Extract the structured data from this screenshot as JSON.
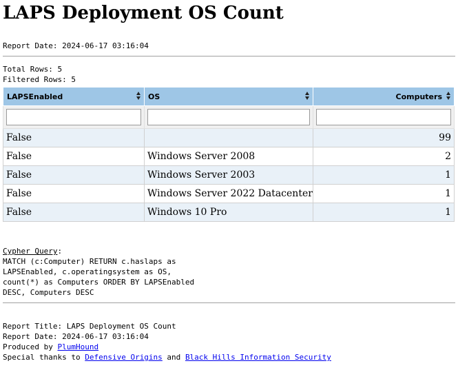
{
  "title": "LAPS Deployment OS Count",
  "report_date_line": "Report Date: 2024-06-17 03:16:04",
  "total_rows_line": "Total Rows: 5",
  "filtered_rows_line": "Filtered Rows: 5",
  "table": {
    "headers": [
      "LAPSEnabled",
      "OS",
      "Computers"
    ],
    "rows": [
      [
        "False",
        "",
        "99"
      ],
      [
        "False",
        "Windows Server 2008",
        "2"
      ],
      [
        "False",
        "Windows Server 2003",
        "1"
      ],
      [
        "False",
        "Windows Server 2022 Datacenter",
        "1"
      ],
      [
        "False",
        "Windows 10 Pro",
        "1"
      ]
    ]
  },
  "cypher": {
    "label": "Cypher Query",
    "colon": ":",
    "lines": [
      "MATCH (c:Computer) RETURN c.haslaps as",
      "LAPSEnabled, c.operatingsystem as OS,",
      "count(*) as Computers ORDER BY LAPSEnabled",
      "DESC, Computers DESC"
    ]
  },
  "footer": {
    "report_title_line": "Report Title: LAPS Deployment OS Count",
    "report_date_line": "Report Date: 2024-06-17 03:16:04",
    "produced_by_prefix": "Produced by ",
    "produced_by_link": "PlumHound",
    "thanks_prefix": "Special thanks to ",
    "thanks_link1": "Defensive Origins",
    "thanks_and": " and ",
    "thanks_link2": "Black Hills Information Security"
  }
}
